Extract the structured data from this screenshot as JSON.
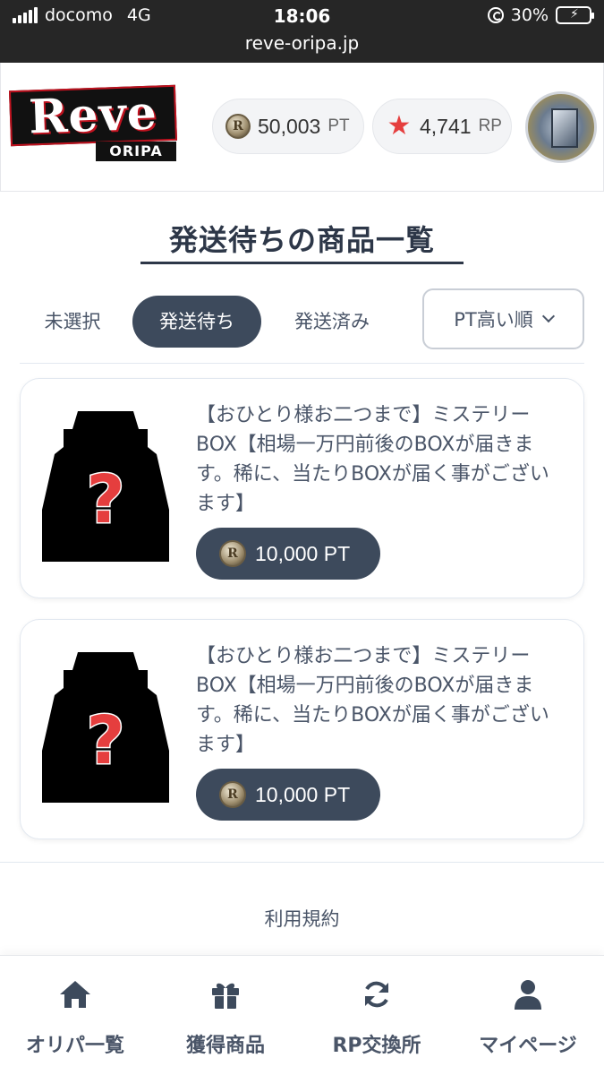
{
  "status_bar": {
    "carrier": "docomo",
    "network": "4G",
    "time": "18:06",
    "url": "reve-oripa.jp",
    "battery": "30%"
  },
  "header": {
    "logo_main": "Reve",
    "logo_sub": "ORIPA",
    "pt_value": "50,003",
    "pt_unit": "PT",
    "rp_value": "4,741",
    "rp_unit": "RP",
    "coin_letter": "R",
    "rp_star_color": "#e53e3e"
  },
  "page_title": "発送待ちの商品一覧",
  "tabs": [
    {
      "label": "未選択"
    },
    {
      "label": "発送待ち",
      "active": true
    },
    {
      "label": "発送済み"
    }
  ],
  "sort": {
    "selected": "PT高い順"
  },
  "items": [
    {
      "title": "【おひとり様お二つまで】ミステリーBOX【相場一万円前後のBOXが届きます。稀に、当たりBOXが届く事がございます】",
      "price": "10,000 PT"
    },
    {
      "title": "【おひとり様お二つまで】ミステリーBOX【相場一万円前後のBOXが届きます。稀に、当たりBOXが届く事がございます】",
      "price": "10,000 PT"
    }
  ],
  "footer": {
    "terms": "利用規約"
  },
  "bottom_nav": [
    {
      "label": "オリパ一覧",
      "icon": "home-icon"
    },
    {
      "label": "獲得商品",
      "icon": "gift-icon"
    },
    {
      "label": "RP交換所",
      "icon": "sync-icon"
    },
    {
      "label": "マイページ",
      "icon": "user-icon"
    }
  ],
  "colors": {
    "accent": "#3d4a5c",
    "text": "#4a5568",
    "mystery_mark": "#e53e3e"
  }
}
